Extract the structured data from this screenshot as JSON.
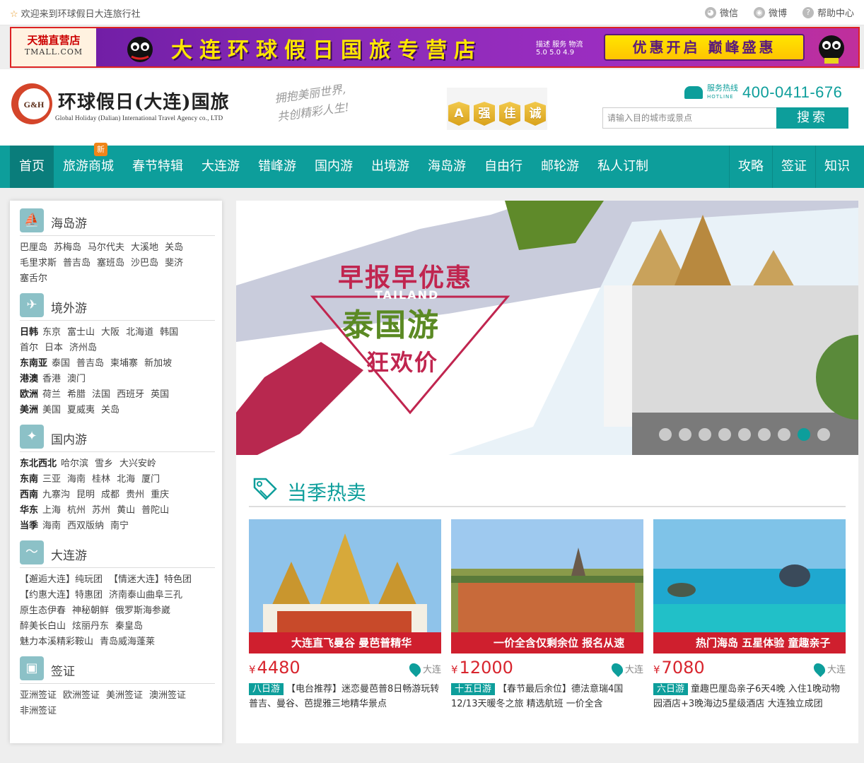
{
  "topbar": {
    "welcome": "欢迎来到环球假日大连旅行社",
    "links": [
      {
        "label": "微信",
        "icon": "wechat-icon"
      },
      {
        "label": "微博",
        "icon": "weibo-icon"
      },
      {
        "label": "帮助中心",
        "icon": "help-icon"
      }
    ]
  },
  "banner": {
    "store_name": "天猫直营店",
    "store_domain": "TMALL.COM",
    "title": "大连环球假日国旅专营店",
    "rating": "描述 服务 物流",
    "rating_scores": "5.0 5.0 4.9",
    "promo": "优惠开启 巅峰盛惠"
  },
  "header": {
    "logo_mark": "G&H",
    "logo_cn": "环球假日(大连)国旅",
    "logo_en": "Global Holiday (Dalian) International Travel Agency co., LTD",
    "slogan_line1": "拥抱美丽世界,",
    "slogan_line2": "共创精彩人生!",
    "badges": [
      "A",
      "强",
      "佳",
      "诚"
    ],
    "hotline_label": "服务热线",
    "hotline_sub": "HOTLINE",
    "hotline_number": "400-0411-676",
    "search_placeholder": "请输入目的城市或景点",
    "search_button": "搜索"
  },
  "nav": {
    "items": [
      "首页",
      "旅游商城",
      "春节特辑",
      "大连游",
      "错峰游",
      "国内游",
      "出境游",
      "海岛游",
      "自由行",
      "邮轮游",
      "私人订制"
    ],
    "new_badge": "新",
    "right_items": [
      "攻略",
      "签证",
      "知识"
    ]
  },
  "sidebar": {
    "sections": [
      {
        "title": "海岛游",
        "icon": "sailboat-icon",
        "rows": [
          {
            "head": "",
            "items": [
              "巴厘岛",
              "苏梅岛",
              "马尔代夫",
              "大溪地",
              "关岛"
            ]
          },
          {
            "head": "",
            "items": [
              "毛里求斯",
              "普吉岛",
              "塞班岛",
              "沙巴岛",
              "斐济"
            ]
          },
          {
            "head": "",
            "items": [
              "塞舌尔"
            ]
          }
        ]
      },
      {
        "title": "境外游",
        "icon": "airplane-icon",
        "rows": [
          {
            "head": "日韩",
            "items": [
              "东京",
              "富士山",
              "大阪",
              "北海道",
              "韩国"
            ]
          },
          {
            "head": "",
            "items": [
              "首尔",
              "日本",
              "济州岛"
            ]
          },
          {
            "head": "东南亚",
            "items": [
              "泰国",
              "普吉岛",
              "柬埔寨",
              "新加坡"
            ]
          },
          {
            "head": "港澳",
            "items": [
              "香港",
              "澳门"
            ]
          },
          {
            "head": "欧洲",
            "items": [
              "荷兰",
              "希腊",
              "法国",
              "西班牙",
              "英国"
            ]
          },
          {
            "head": "美洲",
            "items": [
              "美国",
              "夏威夷",
              "关岛"
            ]
          }
        ]
      },
      {
        "title": "国内游",
        "icon": "stars-icon",
        "rows": [
          {
            "head": "东北西北",
            "items": [
              "哈尔滨",
              "雪乡",
              "大兴安岭"
            ]
          },
          {
            "head": "东南",
            "items": [
              "三亚",
              "海南",
              "桂林",
              "北海",
              "厦门"
            ]
          },
          {
            "head": "西南",
            "items": [
              "九寨沟",
              "昆明",
              "成都",
              "贵州",
              "重庆"
            ]
          },
          {
            "head": "华东",
            "items": [
              "上海",
              "杭州",
              "苏州",
              "黄山",
              "普陀山"
            ]
          },
          {
            "head": "当季",
            "items": [
              "海南",
              "西双版纳",
              "南宁"
            ]
          }
        ]
      },
      {
        "title": "大连游",
        "icon": "dolphin-icon",
        "rows": [
          {
            "head": "",
            "items": [
              "【邂逅大连】纯玩团",
              "【情迷大连】特色团"
            ]
          },
          {
            "head": "",
            "items": [
              "【约惠大连】特惠团",
              "济南泰山曲阜三孔"
            ]
          },
          {
            "head": "",
            "items": [
              "原生态伊春",
              "神秘朝鲜",
              "俄罗斯海参崴"
            ]
          },
          {
            "head": "",
            "items": [
              "醉美长白山",
              "炫丽丹东",
              "秦皇岛"
            ]
          },
          {
            "head": "",
            "items": [
              "魅力本溪精彩鞍山",
              "青岛威海蓬莱"
            ]
          }
        ]
      },
      {
        "title": "签证",
        "icon": "wallet-icon",
        "rows": [
          {
            "head": "",
            "items": [
              "亚洲签证",
              "欧洲签证",
              "美洲签证",
              "澳洲签证"
            ]
          },
          {
            "head": "",
            "items": [
              "非洲签证"
            ]
          }
        ]
      }
    ]
  },
  "slider": {
    "line1": "早报早优惠",
    "line2": "TAILAND",
    "line3": "泰国游",
    "line4": "狂欢价",
    "dots": 9,
    "active_dot": 8
  },
  "hot": {
    "title": "当季热卖",
    "cards": [
      {
        "strip": "大连直飞曼谷 曼芭普精华",
        "currency": "¥",
        "price": "4480",
        "location": "大连",
        "days": "八日游",
        "desc": "【电台推荐】迷恋曼芭普8日畅游玩转普吉、曼谷、芭提雅三地精华景点"
      },
      {
        "strip": "一价全含仅剩余位 报名从速",
        "currency": "¥",
        "price": "12000",
        "location": "大连",
        "days": "十五日游",
        "desc": "【春节最后余位】德法意瑞4国12/13天暖冬之旅 精选航班 一价全含"
      },
      {
        "strip": "热门海岛 五星体验 童趣亲子",
        "currency": "¥",
        "price": "7080",
        "location": "大连",
        "days": "六日游",
        "desc": "童趣巴厘岛亲子6天4晚 入住1晚动物园酒店+3晚海边5星级酒店 大连独立成团"
      }
    ]
  }
}
